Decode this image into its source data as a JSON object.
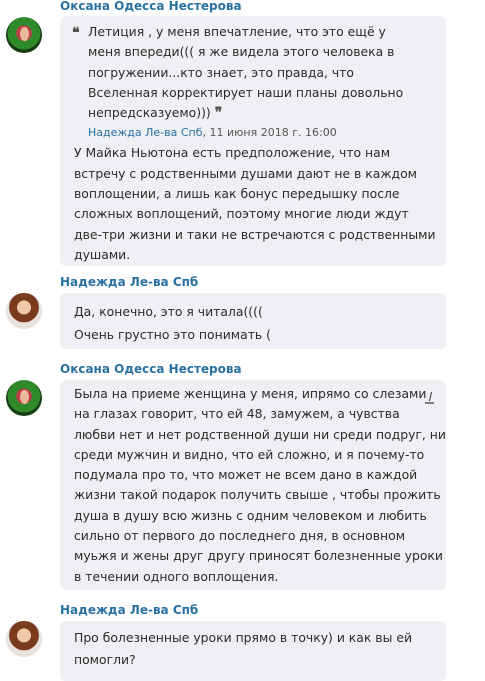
{
  "messages": [
    {
      "author": "Оксана Одесса Нестерова",
      "avatar": "oksana-avatar",
      "quote": {
        "lines": [
          "Летиция , у меня впечатление, что это ещё у",
          "меня впереди((( я же видела этого человека в",
          "погружении...кто знает, это правда, что",
          "Вселенная корректирует наши планы довольно",
          "непредсказуемо)))"
        ],
        "author": "Надежда Ле-ва Спб",
        "date": ", 11 июня 2018 г. 16:00"
      },
      "lines": [
        "У Майка Ньютона есть предположение, что нам",
        "встречу с родственными душами дают не в каждом",
        "воплощении, а лишь как бонус передышку после",
        "сложных воплощений, поэтому многие люди ждут",
        "две-три жизни и таки не встречаются с родственными",
        "душами."
      ]
    },
    {
      "author": "Надежда Ле-ва Спб",
      "avatar": "nadezhda-avatar",
      "lines": [
        "Да, конечно, это я читала((((",
        "Очень грустно это понимать ("
      ]
    },
    {
      "author": "Оксана Одесса Нестерова",
      "avatar": "oksana-avatar",
      "lines": [
        "Была на приеме женщина у меня, ипрямо со слезами",
        "на глазах говорит, что ей 48, замужем, а чувства",
        "любви нет и нет родственной души ни среди подруг, ни",
        "среди мужчин и видно, что ей сложно, и я почему-то",
        "подумала про то, что может не всем дано в каждой",
        "жизни такой подарок получить свыше , чтобы прожить",
        "душа в душу всю жизнь с одним человеком и любить",
        "сильно от первого до последнего дня, в основном",
        "муьжя и жены друг другу приносят болезненные уроки",
        "в течении одного воплощения."
      ]
    },
    {
      "author": "Надежда Ле-ва Спб",
      "avatar": "nadezhda-avatar",
      "lines": [
        "Про болезненные уроки прямо в точку) и как вы ей",
        "помогли?"
      ]
    }
  ],
  "colors": {
    "author": "#2a71a3",
    "bubble": "#eef0f3",
    "text": "#2b2b2b"
  }
}
